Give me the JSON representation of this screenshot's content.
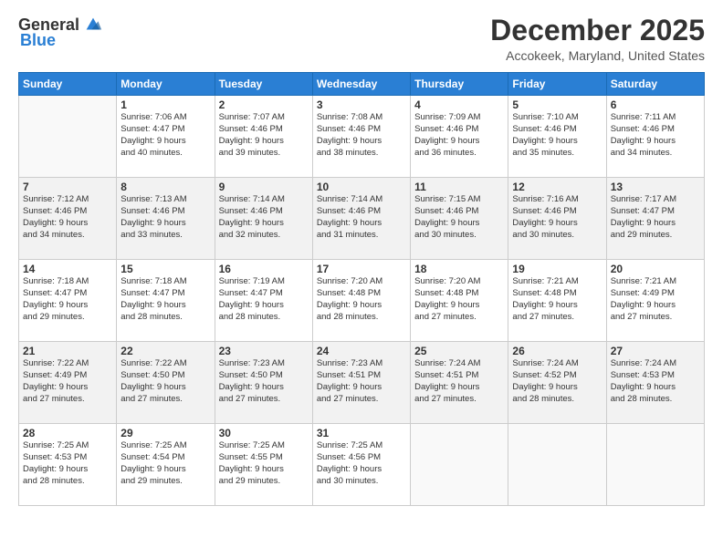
{
  "logo": {
    "general": "General",
    "blue": "Blue"
  },
  "title": "December 2025",
  "location": "Accokeek, Maryland, United States",
  "days_of_week": [
    "Sunday",
    "Monday",
    "Tuesday",
    "Wednesday",
    "Thursday",
    "Friday",
    "Saturday"
  ],
  "weeks": [
    [
      {
        "day": "",
        "info": ""
      },
      {
        "day": "1",
        "info": "Sunrise: 7:06 AM\nSunset: 4:47 PM\nDaylight: 9 hours\nand 40 minutes."
      },
      {
        "day": "2",
        "info": "Sunrise: 7:07 AM\nSunset: 4:46 PM\nDaylight: 9 hours\nand 39 minutes."
      },
      {
        "day": "3",
        "info": "Sunrise: 7:08 AM\nSunset: 4:46 PM\nDaylight: 9 hours\nand 38 minutes."
      },
      {
        "day": "4",
        "info": "Sunrise: 7:09 AM\nSunset: 4:46 PM\nDaylight: 9 hours\nand 36 minutes."
      },
      {
        "day": "5",
        "info": "Sunrise: 7:10 AM\nSunset: 4:46 PM\nDaylight: 9 hours\nand 35 minutes."
      },
      {
        "day": "6",
        "info": "Sunrise: 7:11 AM\nSunset: 4:46 PM\nDaylight: 9 hours\nand 34 minutes."
      }
    ],
    [
      {
        "day": "7",
        "info": "Sunrise: 7:12 AM\nSunset: 4:46 PM\nDaylight: 9 hours\nand 34 minutes."
      },
      {
        "day": "8",
        "info": "Sunrise: 7:13 AM\nSunset: 4:46 PM\nDaylight: 9 hours\nand 33 minutes."
      },
      {
        "day": "9",
        "info": "Sunrise: 7:14 AM\nSunset: 4:46 PM\nDaylight: 9 hours\nand 32 minutes."
      },
      {
        "day": "10",
        "info": "Sunrise: 7:14 AM\nSunset: 4:46 PM\nDaylight: 9 hours\nand 31 minutes."
      },
      {
        "day": "11",
        "info": "Sunrise: 7:15 AM\nSunset: 4:46 PM\nDaylight: 9 hours\nand 30 minutes."
      },
      {
        "day": "12",
        "info": "Sunrise: 7:16 AM\nSunset: 4:46 PM\nDaylight: 9 hours\nand 30 minutes."
      },
      {
        "day": "13",
        "info": "Sunrise: 7:17 AM\nSunset: 4:47 PM\nDaylight: 9 hours\nand 29 minutes."
      }
    ],
    [
      {
        "day": "14",
        "info": "Sunrise: 7:18 AM\nSunset: 4:47 PM\nDaylight: 9 hours\nand 29 minutes."
      },
      {
        "day": "15",
        "info": "Sunrise: 7:18 AM\nSunset: 4:47 PM\nDaylight: 9 hours\nand 28 minutes."
      },
      {
        "day": "16",
        "info": "Sunrise: 7:19 AM\nSunset: 4:47 PM\nDaylight: 9 hours\nand 28 minutes."
      },
      {
        "day": "17",
        "info": "Sunrise: 7:20 AM\nSunset: 4:48 PM\nDaylight: 9 hours\nand 28 minutes."
      },
      {
        "day": "18",
        "info": "Sunrise: 7:20 AM\nSunset: 4:48 PM\nDaylight: 9 hours\nand 27 minutes."
      },
      {
        "day": "19",
        "info": "Sunrise: 7:21 AM\nSunset: 4:48 PM\nDaylight: 9 hours\nand 27 minutes."
      },
      {
        "day": "20",
        "info": "Sunrise: 7:21 AM\nSunset: 4:49 PM\nDaylight: 9 hours\nand 27 minutes."
      }
    ],
    [
      {
        "day": "21",
        "info": "Sunrise: 7:22 AM\nSunset: 4:49 PM\nDaylight: 9 hours\nand 27 minutes."
      },
      {
        "day": "22",
        "info": "Sunrise: 7:22 AM\nSunset: 4:50 PM\nDaylight: 9 hours\nand 27 minutes."
      },
      {
        "day": "23",
        "info": "Sunrise: 7:23 AM\nSunset: 4:50 PM\nDaylight: 9 hours\nand 27 minutes."
      },
      {
        "day": "24",
        "info": "Sunrise: 7:23 AM\nSunset: 4:51 PM\nDaylight: 9 hours\nand 27 minutes."
      },
      {
        "day": "25",
        "info": "Sunrise: 7:24 AM\nSunset: 4:51 PM\nDaylight: 9 hours\nand 27 minutes."
      },
      {
        "day": "26",
        "info": "Sunrise: 7:24 AM\nSunset: 4:52 PM\nDaylight: 9 hours\nand 28 minutes."
      },
      {
        "day": "27",
        "info": "Sunrise: 7:24 AM\nSunset: 4:53 PM\nDaylight: 9 hours\nand 28 minutes."
      }
    ],
    [
      {
        "day": "28",
        "info": "Sunrise: 7:25 AM\nSunset: 4:53 PM\nDaylight: 9 hours\nand 28 minutes."
      },
      {
        "day": "29",
        "info": "Sunrise: 7:25 AM\nSunset: 4:54 PM\nDaylight: 9 hours\nand 29 minutes."
      },
      {
        "day": "30",
        "info": "Sunrise: 7:25 AM\nSunset: 4:55 PM\nDaylight: 9 hours\nand 29 minutes."
      },
      {
        "day": "31",
        "info": "Sunrise: 7:25 AM\nSunset: 4:56 PM\nDaylight: 9 hours\nand 30 minutes."
      },
      {
        "day": "",
        "info": ""
      },
      {
        "day": "",
        "info": ""
      },
      {
        "day": "",
        "info": ""
      }
    ]
  ]
}
